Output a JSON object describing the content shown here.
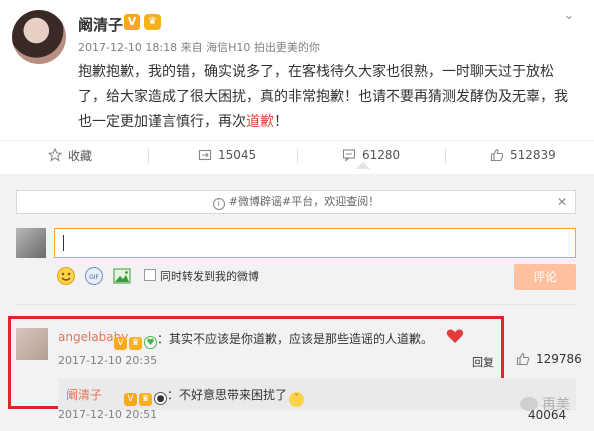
{
  "post": {
    "author": "阚清子",
    "meta": "2017-12-10 18:18 来自 海信H10 拍出更美的你",
    "content_main": "抱歉抱歉，我的错，确实说多了，在客栈待久大家也很熟，一时聊天过于放松了，给大家造成了很大困扰，真的非常抱歉！也请不要再猜测发酵伪及无辜，我也一定更加谨言慎行，再次",
    "content_highlight": "道歉",
    "content_end": "！",
    "actions": {
      "favorite": "收藏",
      "repost": "15045",
      "comment": "61280",
      "like": "512839"
    }
  },
  "compose": {
    "notice": "#微博辟谣#平台，欢迎查阅！",
    "sync_label": "同时转发到我的微博",
    "submit": "评论"
  },
  "comment": {
    "author": "angelababy",
    "text": "：其实不应该是你道歉，应该是那些造谣的人道歉。",
    "time": "2017-12-10 20:35",
    "reply_label": "回复",
    "likes": "129786"
  },
  "reply": {
    "author": "阚清子",
    "text": "：不好意思带来困扰了",
    "time": "2017-12-10 20:51",
    "likes": "40064"
  },
  "watermark": "再美",
  "colors": {
    "accent": "#eb7350",
    "highlight": "#e0493b",
    "badge": "#f7a81b",
    "box": "#e0252b"
  }
}
